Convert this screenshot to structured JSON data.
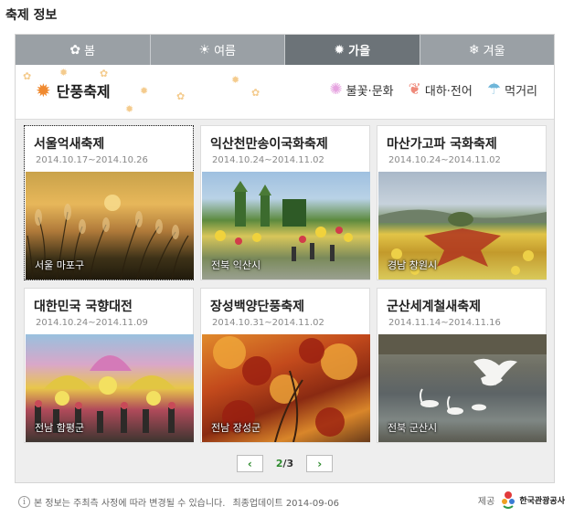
{
  "page_title": "축제 정보",
  "tabs": [
    {
      "label": "봄",
      "icon": "blossom-icon",
      "glyph": "✿"
    },
    {
      "label": "여름",
      "icon": "sun-icon",
      "glyph": "☀"
    },
    {
      "label": "가을",
      "icon": "maple-leaf-icon",
      "glyph": "✹"
    },
    {
      "label": "겨울",
      "icon": "snowflake-icon",
      "glyph": "❄"
    }
  ],
  "active_tab": "가을",
  "subcategory": {
    "current": "단풍축제",
    "icon": "maple-leaf-icon"
  },
  "categories": [
    {
      "label": "불꽃·문화",
      "icon": "fireworks-icon"
    },
    {
      "label": "대하·전어",
      "icon": "shrimp-icon"
    },
    {
      "label": "먹거리",
      "icon": "mushroom-icon"
    }
  ],
  "festivals": [
    {
      "title": "서울억새축제",
      "dates": "2014.10.17~2014.10.26",
      "location": "서울 마포구"
    },
    {
      "title": "익산천만송이국화축제",
      "dates": "2014.10.24~2014.11.02",
      "location": "전북 익산시"
    },
    {
      "title": "마산가고파 국화축제",
      "dates": "2014.10.24~2014.11.02",
      "location": "경남 창원시"
    },
    {
      "title": "대한민국 국향대전",
      "dates": "2014.10.24~2014.11.09",
      "location": "전남 함평군"
    },
    {
      "title": "장성백양단풍축제",
      "dates": "2014.10.31~2014.11.02",
      "location": "전남 장성군"
    },
    {
      "title": "군산세계철새축제",
      "dates": "2014.11.14~2014.11.16",
      "location": "전북 군산시"
    }
  ],
  "pagination": {
    "current": "2",
    "separator": "/",
    "total": "3",
    "prev": "‹",
    "next": "›"
  },
  "footer": {
    "notice": "본 정보는 주최측 사정에 따라 변경될 수 있습니다.",
    "updated": "최종업데이트 2014-09-06"
  },
  "provider": {
    "label": "제공",
    "org": "한국관광공사"
  },
  "colors": {
    "tab_bg": "#9aa0a5",
    "tab_active": "#6c7378",
    "pager_green": "#2e8b2e",
    "maple": "#f08a30"
  }
}
